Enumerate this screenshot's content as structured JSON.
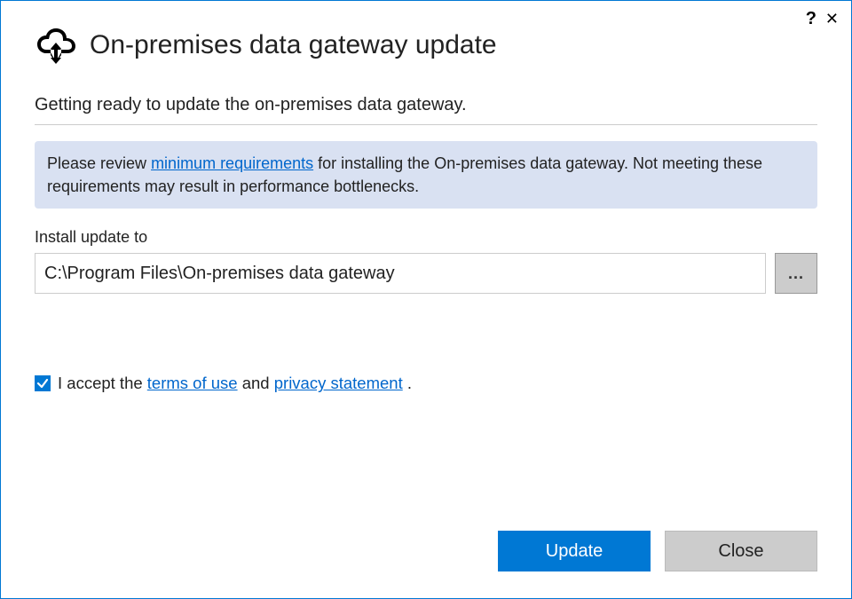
{
  "header": {
    "title": "On-premises data gateway update"
  },
  "subtitle": "Getting ready to update the on-premises data gateway.",
  "info": {
    "prefix": "Please review ",
    "link": "minimum requirements",
    "suffix": " for installing the On-premises data gateway. Not meeting these requirements may result in performance bottlenecks."
  },
  "install": {
    "label": "Install update to",
    "path": "C:\\Program Files\\On-premises data gateway",
    "browse": "..."
  },
  "accept": {
    "checked": true,
    "pre": "I accept the ",
    "terms": "terms of use",
    "mid": " and ",
    "privacy": "privacy statement",
    "post": " ."
  },
  "buttons": {
    "update": "Update",
    "close": "Close"
  },
  "titlebar": {
    "help": "?",
    "close": "✕"
  }
}
